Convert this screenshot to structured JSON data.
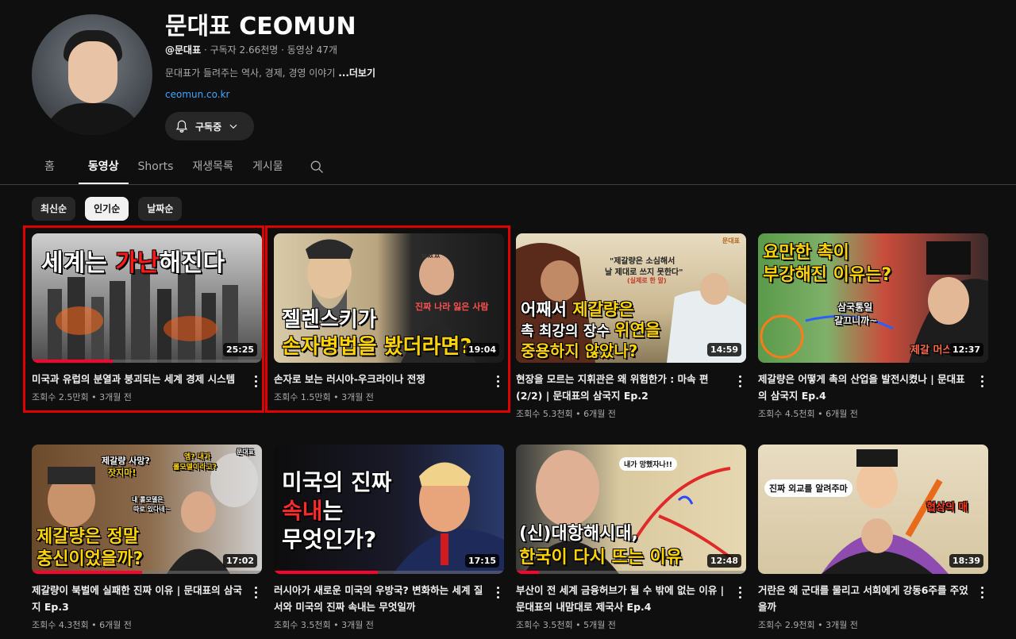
{
  "channel": {
    "name": "문대표 CEOMUN",
    "handle": "@문대표",
    "stats": " · 구독자 2.66천명 · 동영상 47개",
    "description": "문대표가 들려주는 역사, 경제, 경영 이야기 ",
    "more_label": "...더보기",
    "link": "ceomun.co.kr",
    "subscribe_label": "구독중"
  },
  "tabs": [
    "홈",
    "동영상",
    "Shorts",
    "재생목록",
    "게시물"
  ],
  "chips": [
    "최신순",
    "인기순",
    "날짜순"
  ],
  "videos": [
    {
      "title": "미국과 유럽의 분열과 붕괴되는 세계 경제 시스템",
      "meta": "조회수 2.5만회 • 3개월 전",
      "duration": "25:25",
      "thumb_text": [
        "세계는 ",
        "가난",
        "해진다"
      ],
      "progress": 0.35
    },
    {
      "title": "손자로 보는 러시아-우크라이나 전쟁",
      "meta": "조회수 1.5만회 • 3개월 전",
      "duration": "19:04",
      "thumb_text": [
        "젤렌스키가",
        "손자병법을 봤더라면?",
        "진짜 나라 잃은 사람",
        "ㅉㅉㅉ"
      ],
      "progress": 0
    },
    {
      "title": "현장을 모르는 지휘관은 왜 위험한가 : 마속 편 (2/2) | 문대표의 삼국지 Ep.2",
      "meta": "조회수 5.3천회 • 6개월 전",
      "duration": "14:59",
      "thumb_text": [
        "어째서 ",
        "제갈량은",
        "촉 최강의 장수 ",
        "위연을",
        "중용하지 않았나?",
        "\"제갈량은 소심해서",
        "날 제대로 쓰지 못한다\"",
        "(실제로 한 말)",
        "문대표"
      ],
      "progress": 0
    },
    {
      "title": "제갈량은 어떻게 촉의 산업을 발전시켰나 | 문대표의 삼국지 Ep.4",
      "meta": "조회수 4.5천회 • 6개월 전",
      "duration": "12:37",
      "thumb_text": [
        "요만한 촉이",
        "부강해진 이유는?",
        "삼국통일",
        "갈끄니까~",
        "제갈 머스"
      ],
      "progress": 0
    },
    {
      "title": "제갈량이 북벌에 실패한 진짜 이유 | 문대표의 삼국지 Ep.3",
      "meta": "조회수 4.3천회 • 6개월 전",
      "duration": "17:02",
      "thumb_text": [
        "제갈량은 정말",
        "충신이었을까?",
        "제갈량 사망?",
        "잣지마!",
        "엥? 내가",
        "롤모델이라고?",
        "내 롤모델은",
        "따로 있다네~",
        "문대표"
      ],
      "progress": 0.48
    },
    {
      "title": "러시아가 새로운 미국의 우방국? 변화하는 세계 질서와 미국의 진짜 속내는 무엇일까",
      "meta": "조회수 3.5천회 • 3개월 전",
      "duration": "17:15",
      "thumb_text": [
        "미국의 진짜",
        "속내",
        "는",
        "무엇인가?"
      ],
      "progress": 0.45
    },
    {
      "title": "부산이 전 세계 금융허브가 될 수 밖에 없는 이유 | 문대표의 내맘대로 제국사 Ep.4",
      "meta": "조회수 3.5천회 • 5개월 전",
      "duration": "12:48",
      "thumb_text": [
        "(신)대항해시대,",
        "한국이 다시 뜨는 이유",
        "내가 망했자나!!"
      ],
      "progress": 0.1
    },
    {
      "title": "거란은 왜 군대를 물리고 서희에게 강동6주를 주었을까",
      "meta": "조회수 2.9천회 • 3개월 전",
      "duration": "18:39",
      "thumb_text": [
        "진짜 외교를 알려주마",
        "협상의 매"
      ],
      "progress": 0
    }
  ],
  "colors": {
    "background": "#0f0f0f",
    "accent_red": "#ff0033",
    "highlight_box": "#e10000",
    "link_blue": "#3ea6ff",
    "thumb_yellow": "#ffd400"
  }
}
